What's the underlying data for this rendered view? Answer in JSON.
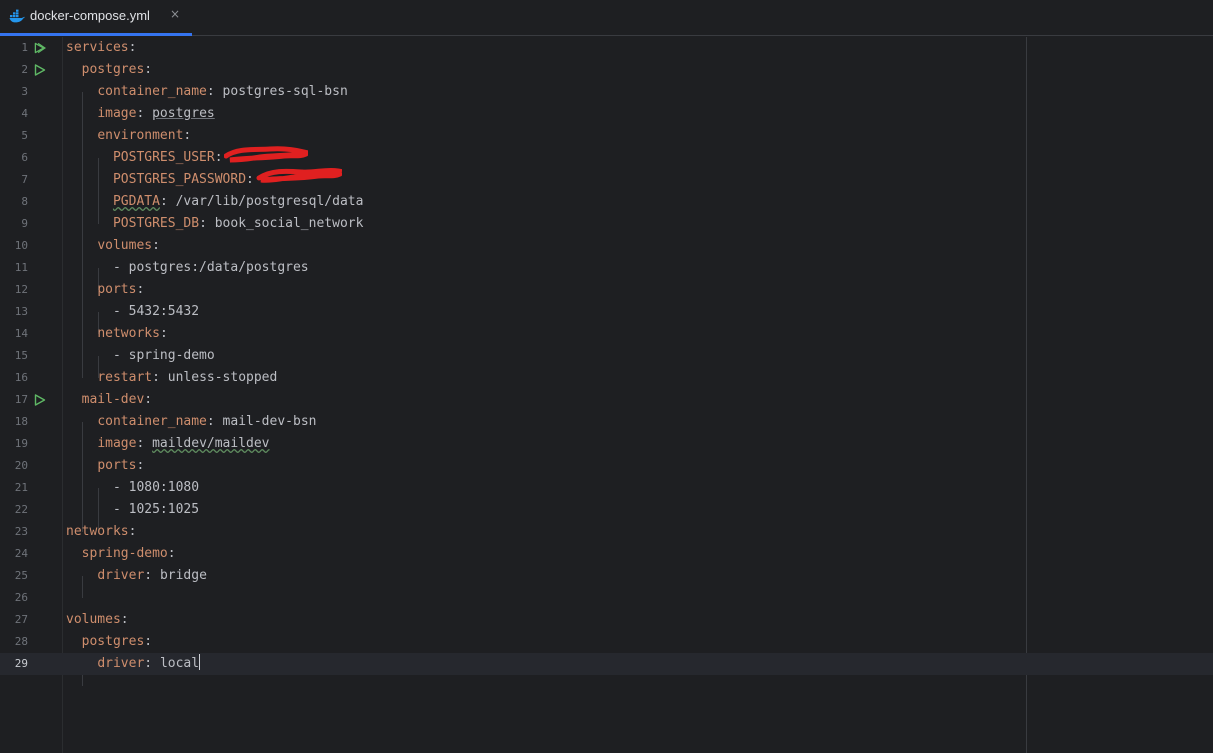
{
  "tab": {
    "filename": "docker-compose.yml",
    "close": "×"
  },
  "lines": [
    {
      "n": "1",
      "parts": [
        [
          "key",
          "services"
        ],
        [
          "punct",
          ":"
        ]
      ],
      "run": true
    },
    {
      "n": "2",
      "parts": [
        [
          "sp",
          "  "
        ],
        [
          "key",
          "postgres"
        ],
        [
          "punct",
          ":"
        ]
      ],
      "run": true
    },
    {
      "n": "3",
      "parts": [
        [
          "sp",
          "    "
        ],
        [
          "key",
          "container_name"
        ],
        [
          "punct",
          ": "
        ],
        [
          "val",
          "postgres-sql-bsn"
        ]
      ]
    },
    {
      "n": "4",
      "parts": [
        [
          "sp",
          "    "
        ],
        [
          "key",
          "image"
        ],
        [
          "punct",
          ": "
        ],
        [
          "ul",
          "postgres"
        ]
      ]
    },
    {
      "n": "5",
      "parts": [
        [
          "sp",
          "    "
        ],
        [
          "key",
          "environment"
        ],
        [
          "punct",
          ":"
        ]
      ]
    },
    {
      "n": "6",
      "parts": [
        [
          "sp",
          "      "
        ],
        [
          "key",
          "POSTGRES_USER"
        ],
        [
          "punct",
          ":"
        ]
      ],
      "redacted": true
    },
    {
      "n": "7",
      "parts": [
        [
          "sp",
          "      "
        ],
        [
          "key",
          "POSTGRES_PASSWORD"
        ],
        [
          "punct",
          ":"
        ]
      ],
      "redacted": true
    },
    {
      "n": "8",
      "parts": [
        [
          "sp",
          "      "
        ],
        [
          "keytypo",
          "PGDATA"
        ],
        [
          "punct",
          ": "
        ],
        [
          "val",
          "/var/lib/postgresql/data"
        ]
      ]
    },
    {
      "n": "9",
      "parts": [
        [
          "sp",
          "      "
        ],
        [
          "key",
          "POSTGRES_DB"
        ],
        [
          "punct",
          ": "
        ],
        [
          "val",
          "book_social_network"
        ]
      ]
    },
    {
      "n": "10",
      "parts": [
        [
          "sp",
          "    "
        ],
        [
          "key",
          "volumes"
        ],
        [
          "punct",
          ":"
        ]
      ]
    },
    {
      "n": "11",
      "parts": [
        [
          "sp",
          "      "
        ],
        [
          "val",
          "- postgres:/data/postgres"
        ]
      ]
    },
    {
      "n": "12",
      "parts": [
        [
          "sp",
          "    "
        ],
        [
          "key",
          "ports"
        ],
        [
          "punct",
          ":"
        ]
      ]
    },
    {
      "n": "13",
      "parts": [
        [
          "sp",
          "      "
        ],
        [
          "val",
          "- 5432:5432"
        ]
      ]
    },
    {
      "n": "14",
      "parts": [
        [
          "sp",
          "    "
        ],
        [
          "key",
          "networks"
        ],
        [
          "punct",
          ":"
        ]
      ]
    },
    {
      "n": "15",
      "parts": [
        [
          "sp",
          "      "
        ],
        [
          "val",
          "- spring-demo"
        ]
      ]
    },
    {
      "n": "16",
      "parts": [
        [
          "sp",
          "    "
        ],
        [
          "key",
          "restart"
        ],
        [
          "punct",
          ": "
        ],
        [
          "val",
          "unless-stopped"
        ]
      ]
    },
    {
      "n": "17",
      "parts": [
        [
          "sp",
          "  "
        ],
        [
          "key",
          "mail-dev"
        ],
        [
          "punct",
          ":"
        ]
      ],
      "run": true
    },
    {
      "n": "18",
      "parts": [
        [
          "sp",
          "    "
        ],
        [
          "key",
          "container_name"
        ],
        [
          "punct",
          ": "
        ],
        [
          "val",
          "mail-dev-bsn"
        ]
      ]
    },
    {
      "n": "19",
      "parts": [
        [
          "sp",
          "    "
        ],
        [
          "key",
          "image"
        ],
        [
          "punct",
          ": "
        ],
        [
          "ultypo",
          "maildev/maildev"
        ]
      ]
    },
    {
      "n": "20",
      "parts": [
        [
          "sp",
          "    "
        ],
        [
          "key",
          "ports"
        ],
        [
          "punct",
          ":"
        ]
      ]
    },
    {
      "n": "21",
      "parts": [
        [
          "sp",
          "      "
        ],
        [
          "val",
          "- 1080:1080"
        ]
      ]
    },
    {
      "n": "22",
      "parts": [
        [
          "sp",
          "      "
        ],
        [
          "val",
          "- 1025:1025"
        ]
      ]
    },
    {
      "n": "23",
      "parts": [
        [
          "key",
          "networks"
        ],
        [
          "punct",
          ":"
        ]
      ]
    },
    {
      "n": "24",
      "parts": [
        [
          "sp",
          "  "
        ],
        [
          "key",
          "spring-demo"
        ],
        [
          "punct",
          ":"
        ]
      ]
    },
    {
      "n": "25",
      "parts": [
        [
          "sp",
          "    "
        ],
        [
          "key",
          "driver"
        ],
        [
          "punct",
          ": "
        ],
        [
          "val",
          "bridge"
        ]
      ]
    },
    {
      "n": "26",
      "parts": []
    },
    {
      "n": "27",
      "parts": [
        [
          "key",
          "volumes"
        ],
        [
          "punct",
          ":"
        ]
      ]
    },
    {
      "n": "28",
      "parts": [
        [
          "sp",
          "  "
        ],
        [
          "key",
          "postgres"
        ],
        [
          "punct",
          ":"
        ]
      ]
    },
    {
      "n": "29",
      "parts": [
        [
          "sp",
          "    "
        ],
        [
          "key",
          "driver"
        ],
        [
          "punct",
          ": "
        ],
        [
          "val",
          "local"
        ]
      ],
      "current": true,
      "caret": true
    }
  ],
  "colors": {
    "key": "#cf8e6d",
    "text": "#bcbec4",
    "accent": "#3574f0",
    "run": "#5fb865",
    "redaction": "#e02020"
  },
  "icons": {
    "tab": "docker-icon",
    "run": "run-gutter-icon",
    "close": "close-icon"
  }
}
